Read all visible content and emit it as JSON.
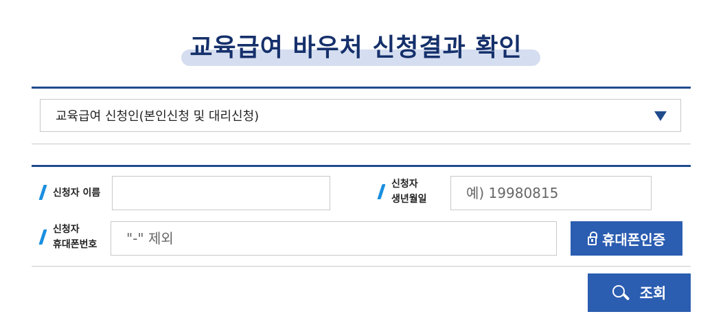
{
  "page": {
    "title": "교육급여 바우처 신청결과 확인"
  },
  "applicant_type": {
    "selected": "교육급여 신청인(본인신청 및 대리신청)"
  },
  "form": {
    "name_label": "신청자 이름",
    "name_value": "",
    "birth_label_line1": "신청자",
    "birth_label_line2": "생년월일",
    "birth_placeholder": "예) 19980815",
    "phone_label_line1": "신청자",
    "phone_label_line2": "휴대폰번호",
    "phone_placeholder": "\"-\" 제외",
    "phone_verify_button": "휴대폰인증",
    "search_button": "조회"
  },
  "colors": {
    "accent": "#2b5db1",
    "title": "#15306b",
    "rule": "#1f4b8c",
    "slash": "#1a8fe0"
  },
  "icons": {
    "verify": "lock-icon",
    "search": "search-icon",
    "dropdown": "dropdown-arrow-icon"
  }
}
